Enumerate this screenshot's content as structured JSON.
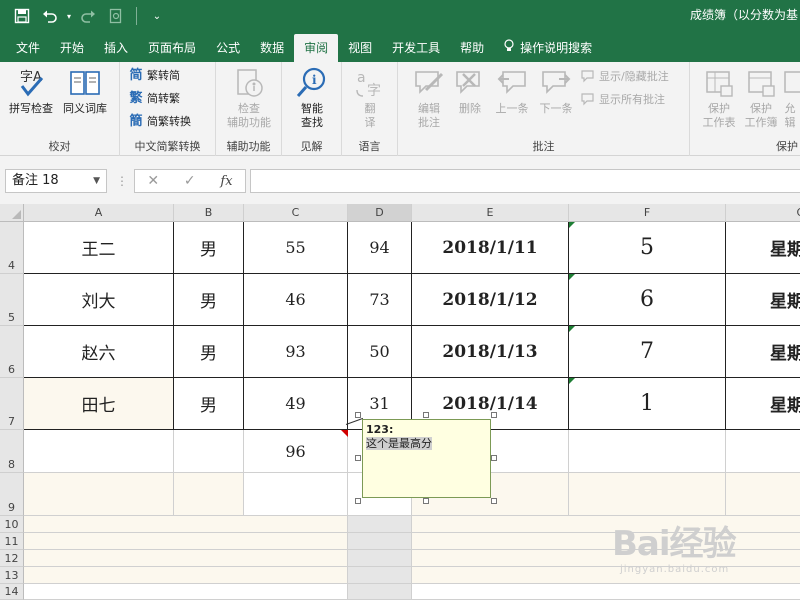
{
  "window": {
    "title": "成绩簿（以分数为基"
  },
  "quick_access": {
    "save_icon": "save-icon",
    "undo_icon": "undo-icon",
    "redo_icon": "redo-icon",
    "print_preview_icon": "print-preview-icon",
    "customize_icon": "customize-qat-icon"
  },
  "tabs": [
    {
      "label": "文件"
    },
    {
      "label": "开始"
    },
    {
      "label": "插入"
    },
    {
      "label": "页面布局"
    },
    {
      "label": "公式"
    },
    {
      "label": "数据"
    },
    {
      "label": "审阅",
      "active": true
    },
    {
      "label": "视图"
    },
    {
      "label": "开发工具"
    },
    {
      "label": "帮助"
    },
    {
      "label": "操作说明搜索"
    }
  ],
  "ribbon": {
    "proofing": {
      "label": "校对",
      "spell_check": "拼写检查",
      "thesaurus": "同义词库"
    },
    "chinese_conversion": {
      "label": "中文简繁转换",
      "to_simplified": "繁转简",
      "to_traditional": "简转繁",
      "convert": "简繁转换"
    },
    "accessibility": {
      "label": "辅助功能",
      "check_line1": "检查",
      "check_line2": "辅助功能"
    },
    "insights": {
      "label": "见解",
      "smart_line1": "智能",
      "smart_line2": "查找"
    },
    "language": {
      "label": "语言",
      "translate_line1": "翻",
      "translate_line2": "译"
    },
    "comments": {
      "label": "批注",
      "edit_line1": "编辑",
      "edit_line2": "批注",
      "delete": "删除",
      "previous": "上一条",
      "next": "下一条",
      "show_hide": "显示/隐藏批注",
      "show_all": "显示所有批注"
    },
    "protect": {
      "label": "保护",
      "sheet_line1": "保护",
      "sheet_line2": "工作表",
      "workbook_line1": "保护",
      "workbook_line2": "工作簿",
      "allow_line1": "允",
      "allow_line2": "辑"
    }
  },
  "formula_bar": {
    "name_box": "备注 18",
    "cancel_icon": "cancel-icon",
    "enter_icon": "enter-icon",
    "fx_label": "fx",
    "formula": ""
  },
  "sheet": {
    "columns": [
      "A",
      "B",
      "C",
      "D",
      "E",
      "F",
      "G"
    ],
    "rows": [
      {
        "row": "4",
        "cells": [
          "王二",
          "男",
          "55",
          "94",
          "2018/1/11",
          "5",
          "星期"
        ]
      },
      {
        "row": "5",
        "cells": [
          "刘大",
          "男",
          "46",
          "73",
          "2018/1/12",
          "6",
          "星期"
        ]
      },
      {
        "row": "6",
        "cells": [
          "赵六",
          "男",
          "93",
          "50",
          "2018/1/13",
          "7",
          "星期"
        ]
      },
      {
        "row": "7",
        "cells": [
          "田七",
          "男",
          "49",
          "31",
          "2018/1/14",
          "1",
          "星期"
        ]
      },
      {
        "row": "8",
        "cells": [
          "",
          "",
          "96",
          "",
          "",
          "",
          ""
        ]
      },
      {
        "row": "9",
        "cells": [
          "",
          "",
          "",
          "",
          "",
          "",
          ""
        ]
      },
      {
        "row": "10",
        "cells": [
          "",
          "",
          "",
          "",
          "",
          "",
          ""
        ]
      },
      {
        "row": "11",
        "cells": [
          "",
          "",
          "",
          "",
          "",
          "",
          ""
        ]
      },
      {
        "row": "12",
        "cells": [
          "",
          "",
          "",
          "",
          "",
          "",
          ""
        ]
      },
      {
        "row": "13",
        "cells": [
          "",
          "",
          "",
          "",
          "",
          "",
          ""
        ]
      },
      {
        "row": "14",
        "cells": [
          "",
          "",
          "",
          "",
          "",
          "",
          ""
        ]
      }
    ]
  },
  "comment": {
    "author": "123:",
    "text": "这个是最高分"
  },
  "watermark": {
    "brand": "Bai经验",
    "url": "jingyan.baidu.com"
  },
  "colors": {
    "excel_green": "#217346",
    "comment_bg": "#ffffe1",
    "comment_indicator": "#d00000",
    "error_indicator": "#1e7e34"
  }
}
